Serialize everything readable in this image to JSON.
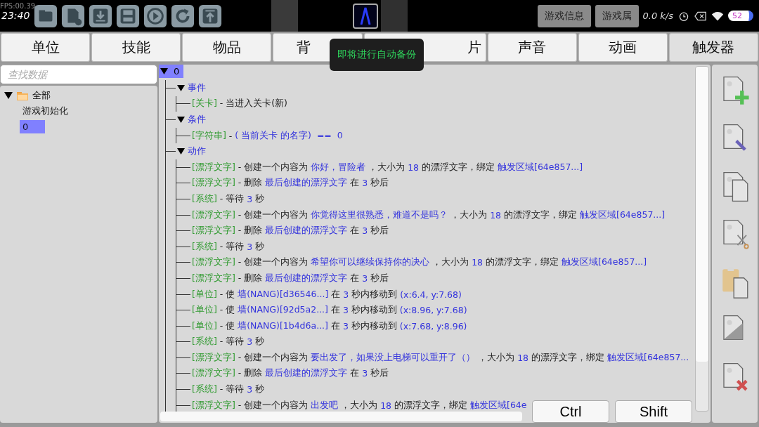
{
  "status_bar": {
    "fps": "FPS:00.39",
    "time": "23:40",
    "speed": "0.0 k/s",
    "battery": "52"
  },
  "top_buttons": [
    {
      "label": "游戏信息"
    },
    {
      "label": "游戏属"
    }
  ],
  "tabs": [
    {
      "label": "单位",
      "selected": false
    },
    {
      "label": "技能",
      "selected": false
    },
    {
      "label": "物品",
      "selected": false
    },
    {
      "label": "背",
      "selected": false
    },
    {
      "label": "片",
      "selected": false
    },
    {
      "label": "声音",
      "selected": false
    },
    {
      "label": "动画",
      "selected": false
    },
    {
      "label": "触发器",
      "selected": true
    }
  ],
  "tooltip": "即将进行自动备份",
  "search": {
    "placeholder": "查找数据"
  },
  "sidebar": {
    "items": [
      {
        "label": "全部",
        "expanded": true,
        "children": [
          {
            "label": "游戏初始化",
            "selected": false
          },
          {
            "label": "0",
            "selected": true
          }
        ]
      }
    ]
  },
  "tree": {
    "label": "0",
    "selected": true,
    "expanded": true,
    "children": [
      {
        "label": "事件",
        "expanded": true,
        "children": [
          {
            "segments": [
              {
                "kind": "tag",
                "text": "[关卡]"
              },
              {
                "kind": "plain",
                "text": " - 当进入关卡(新)"
              }
            ]
          }
        ]
      },
      {
        "label": "条件",
        "expanded": true,
        "children": [
          {
            "segments": [
              {
                "kind": "tag",
                "text": "[字符串]"
              },
              {
                "kind": "plain",
                "text": " - "
              },
              {
                "kind": "value",
                "text": "( 当前关卡 的名字)  ==  0"
              }
            ]
          }
        ]
      },
      {
        "label": "动作",
        "expanded": true,
        "children": [
          {
            "segments": [
              {
                "kind": "tag",
                "text": "[漂浮文字]"
              },
              {
                "kind": "plain",
                "text": " - 创建一个内容为 "
              },
              {
                "kind": "value",
                "text": "你好，冒险者"
              },
              {
                "kind": "plain",
                "text": " ，大小为 "
              },
              {
                "kind": "value",
                "text": "18"
              },
              {
                "kind": "plain",
                "text": " 的漂浮文字，绑定 "
              },
              {
                "kind": "value",
                "text": "触发区域[64e857...]"
              }
            ]
          },
          {
            "segments": [
              {
                "kind": "tag",
                "text": "[漂浮文字]"
              },
              {
                "kind": "plain",
                "text": " - 删除 "
              },
              {
                "kind": "value",
                "text": "最后创建的漂浮文字"
              },
              {
                "kind": "plain",
                "text": " 在 "
              },
              {
                "kind": "value",
                "text": "3"
              },
              {
                "kind": "plain",
                "text": " 秒后"
              }
            ]
          },
          {
            "segments": [
              {
                "kind": "tag",
                "text": "[系统]"
              },
              {
                "kind": "plain",
                "text": " - 等待 "
              },
              {
                "kind": "value",
                "text": "3"
              },
              {
                "kind": "plain",
                "text": " 秒"
              }
            ]
          },
          {
            "segments": [
              {
                "kind": "tag",
                "text": "[漂浮文字]"
              },
              {
                "kind": "plain",
                "text": " - 创建一个内容为 "
              },
              {
                "kind": "value",
                "text": "你觉得这里很熟悉，难道不是吗？"
              },
              {
                "kind": "plain",
                "text": " ，大小为 "
              },
              {
                "kind": "value",
                "text": "18"
              },
              {
                "kind": "plain",
                "text": " 的漂浮文字，绑定 "
              },
              {
                "kind": "value",
                "text": "触发区域[64e857...]"
              }
            ]
          },
          {
            "segments": [
              {
                "kind": "tag",
                "text": "[漂浮文字]"
              },
              {
                "kind": "plain",
                "text": " - 删除 "
              },
              {
                "kind": "value",
                "text": "最后创建的漂浮文字"
              },
              {
                "kind": "plain",
                "text": " 在 "
              },
              {
                "kind": "value",
                "text": "3"
              },
              {
                "kind": "plain",
                "text": " 秒后"
              }
            ]
          },
          {
            "segments": [
              {
                "kind": "tag",
                "text": "[系统]"
              },
              {
                "kind": "plain",
                "text": " - 等待 "
              },
              {
                "kind": "value",
                "text": "3"
              },
              {
                "kind": "plain",
                "text": " 秒"
              }
            ]
          },
          {
            "segments": [
              {
                "kind": "tag",
                "text": "[漂浮文字]"
              },
              {
                "kind": "plain",
                "text": " - 创建一个内容为 "
              },
              {
                "kind": "value",
                "text": "希望你可以继续保持你的决心"
              },
              {
                "kind": "plain",
                "text": " ，大小为 "
              },
              {
                "kind": "value",
                "text": "18"
              },
              {
                "kind": "plain",
                "text": " 的漂浮文字，绑定 "
              },
              {
                "kind": "value",
                "text": "触发区域[64e857...]"
              }
            ]
          },
          {
            "segments": [
              {
                "kind": "tag",
                "text": "[漂浮文字]"
              },
              {
                "kind": "plain",
                "text": " - 删除 "
              },
              {
                "kind": "value",
                "text": "最后创建的漂浮文字"
              },
              {
                "kind": "plain",
                "text": " 在 "
              },
              {
                "kind": "value",
                "text": "3"
              },
              {
                "kind": "plain",
                "text": " 秒后"
              }
            ]
          },
          {
            "segments": [
              {
                "kind": "tag",
                "text": "[单位]"
              },
              {
                "kind": "plain",
                "text": " - 使 "
              },
              {
                "kind": "value",
                "text": "墙(NANG)[d36546...]"
              },
              {
                "kind": "plain",
                "text": " 在 "
              },
              {
                "kind": "value",
                "text": "3"
              },
              {
                "kind": "plain",
                "text": " 秒内移动到 "
              },
              {
                "kind": "value",
                "text": "(x:6.4, y:7.68)"
              }
            ]
          },
          {
            "segments": [
              {
                "kind": "tag",
                "text": "[单位]"
              },
              {
                "kind": "plain",
                "text": " - 使 "
              },
              {
                "kind": "value",
                "text": "墙(NANG)[92d5a2...]"
              },
              {
                "kind": "plain",
                "text": " 在 "
              },
              {
                "kind": "value",
                "text": "3"
              },
              {
                "kind": "plain",
                "text": " 秒内移动到 "
              },
              {
                "kind": "value",
                "text": "(x:8.96, y:7.68)"
              }
            ]
          },
          {
            "segments": [
              {
                "kind": "tag",
                "text": "[单位]"
              },
              {
                "kind": "plain",
                "text": " - 使 "
              },
              {
                "kind": "value",
                "text": "墙(NANG)[1b4d6a...]"
              },
              {
                "kind": "plain",
                "text": " 在 "
              },
              {
                "kind": "value",
                "text": "3"
              },
              {
                "kind": "plain",
                "text": " 秒内移动到 "
              },
              {
                "kind": "value",
                "text": "(x:7.68, y:8.96)"
              }
            ]
          },
          {
            "segments": [
              {
                "kind": "tag",
                "text": "[系统]"
              },
              {
                "kind": "plain",
                "text": " - 等待 "
              },
              {
                "kind": "value",
                "text": "3"
              },
              {
                "kind": "plain",
                "text": " 秒"
              }
            ]
          },
          {
            "segments": [
              {
                "kind": "tag",
                "text": "[漂浮文字]"
              },
              {
                "kind": "plain",
                "text": " - 创建一个内容为 "
              },
              {
                "kind": "value",
                "text": "要出发了，如果没上电梯可以重开了（）"
              },
              {
                "kind": "plain",
                "text": " ，大小为 "
              },
              {
                "kind": "value",
                "text": "18"
              },
              {
                "kind": "plain",
                "text": " 的漂浮文字，绑定 "
              },
              {
                "kind": "value",
                "text": "触发区域[64e857..."
              }
            ]
          },
          {
            "segments": [
              {
                "kind": "tag",
                "text": "[漂浮文字]"
              },
              {
                "kind": "plain",
                "text": " - 删除 "
              },
              {
                "kind": "value",
                "text": "最后创建的漂浮文字"
              },
              {
                "kind": "plain",
                "text": " 在 "
              },
              {
                "kind": "value",
                "text": "3"
              },
              {
                "kind": "plain",
                "text": " 秒后"
              }
            ]
          },
          {
            "segments": [
              {
                "kind": "tag",
                "text": "[系统]"
              },
              {
                "kind": "plain",
                "text": " - 等待 "
              },
              {
                "kind": "value",
                "text": "3"
              },
              {
                "kind": "plain",
                "text": " 秒"
              }
            ]
          },
          {
            "segments": [
              {
                "kind": "tag",
                "text": "[漂浮文字]"
              },
              {
                "kind": "plain",
                "text": " - 创建一个内容为 "
              },
              {
                "kind": "value",
                "text": "出发吧"
              },
              {
                "kind": "plain",
                "text": " ，大小为 "
              },
              {
                "kind": "value",
                "text": "18"
              },
              {
                "kind": "plain",
                "text": " 的漂浮文字，绑定 "
              },
              {
                "kind": "value",
                "text": "触发区域[64e"
              }
            ]
          }
        ]
      }
    ]
  },
  "keys": [
    {
      "label": "Ctrl"
    },
    {
      "label": "Shift"
    }
  ]
}
